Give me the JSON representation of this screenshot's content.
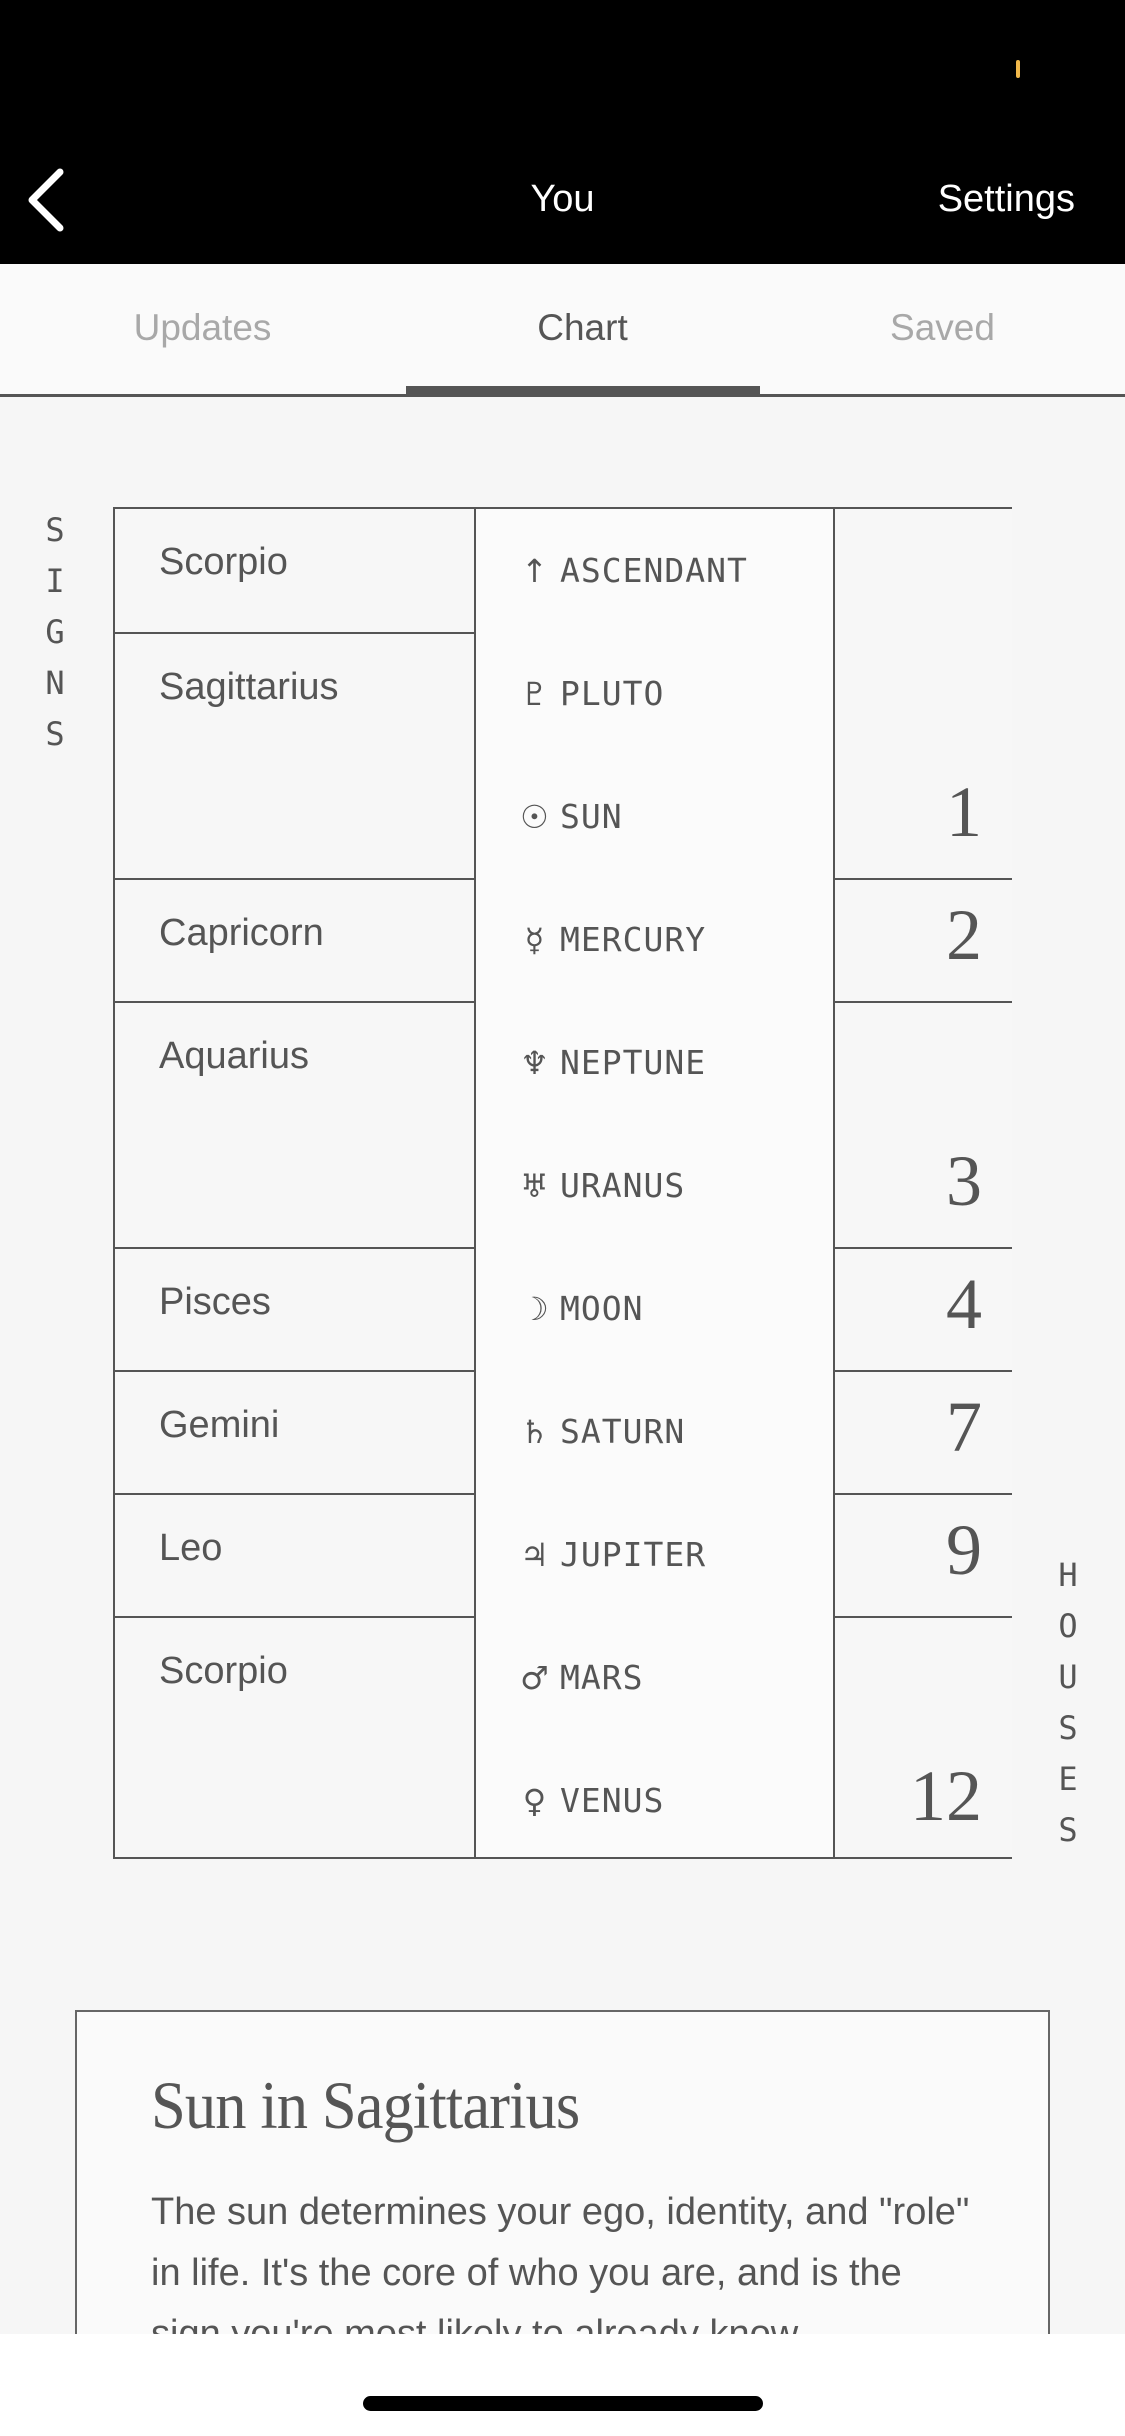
{
  "nav": {
    "back_icon": "chevron-left-icon",
    "title": "You",
    "settings_label": "Settings"
  },
  "tabs": [
    {
      "label": "Updates",
      "active": false
    },
    {
      "label": "Chart",
      "active": true
    },
    {
      "label": "Saved",
      "active": false
    }
  ],
  "side_labels": {
    "signs": [
      "S",
      "I",
      "G",
      "N",
      "S"
    ],
    "houses": [
      "H",
      "O",
      "U",
      "S",
      "E",
      "S"
    ]
  },
  "chart": {
    "signs": [
      {
        "name": "Scorpio",
        "span": 1
      },
      {
        "name": "Sagittarius",
        "span": 2
      },
      {
        "name": "Capricorn",
        "span": 1
      },
      {
        "name": "Aquarius",
        "span": 2
      },
      {
        "name": "Pisces",
        "span": 1
      },
      {
        "name": "Gemini",
        "span": 1
      },
      {
        "name": "Leo",
        "span": 1
      },
      {
        "name": "Scorpio",
        "span": 2
      }
    ],
    "planets": [
      {
        "glyph": "↑",
        "icon": "ascendant-arrow-icon",
        "name": "ASCENDANT"
      },
      {
        "glyph": "♇",
        "icon": "pluto-icon",
        "name": "PLUTO"
      },
      {
        "glyph": "☉",
        "icon": "sun-icon",
        "name": "SUN"
      },
      {
        "glyph": "☿",
        "icon": "mercury-icon",
        "name": "MERCURY"
      },
      {
        "glyph": "♆",
        "icon": "neptune-icon",
        "name": "NEPTUNE"
      },
      {
        "glyph": "♅",
        "icon": "uranus-icon",
        "name": "URANUS"
      },
      {
        "glyph": "☽",
        "icon": "moon-icon",
        "name": "MOON"
      },
      {
        "glyph": "♄",
        "icon": "saturn-icon",
        "name": "SATURN"
      },
      {
        "glyph": "♃",
        "icon": "jupiter-icon",
        "name": "JUPITER"
      },
      {
        "glyph": "♂",
        "icon": "mars-icon",
        "name": "MARS"
      },
      {
        "glyph": "♀",
        "icon": "venus-icon",
        "name": "VENUS"
      }
    ],
    "houses": [
      {
        "number": "1",
        "span": 3
      },
      {
        "number": "2",
        "span": 1
      },
      {
        "number": "3",
        "span": 2
      },
      {
        "number": "4",
        "span": 1
      },
      {
        "number": "7",
        "span": 1
      },
      {
        "number": "9",
        "span": 1
      },
      {
        "number": "12",
        "span": 2
      }
    ]
  },
  "card": {
    "title": "Sun in Sagittarius",
    "body": "The sun determines your ego, identity, and \"role\" in life. It's the core of who you are, and is the sign you're most likely to already know"
  },
  "colors": {
    "status_accent": "#f0b84a",
    "text": "#555555",
    "inactive_tab": "#a8a8a8"
  }
}
